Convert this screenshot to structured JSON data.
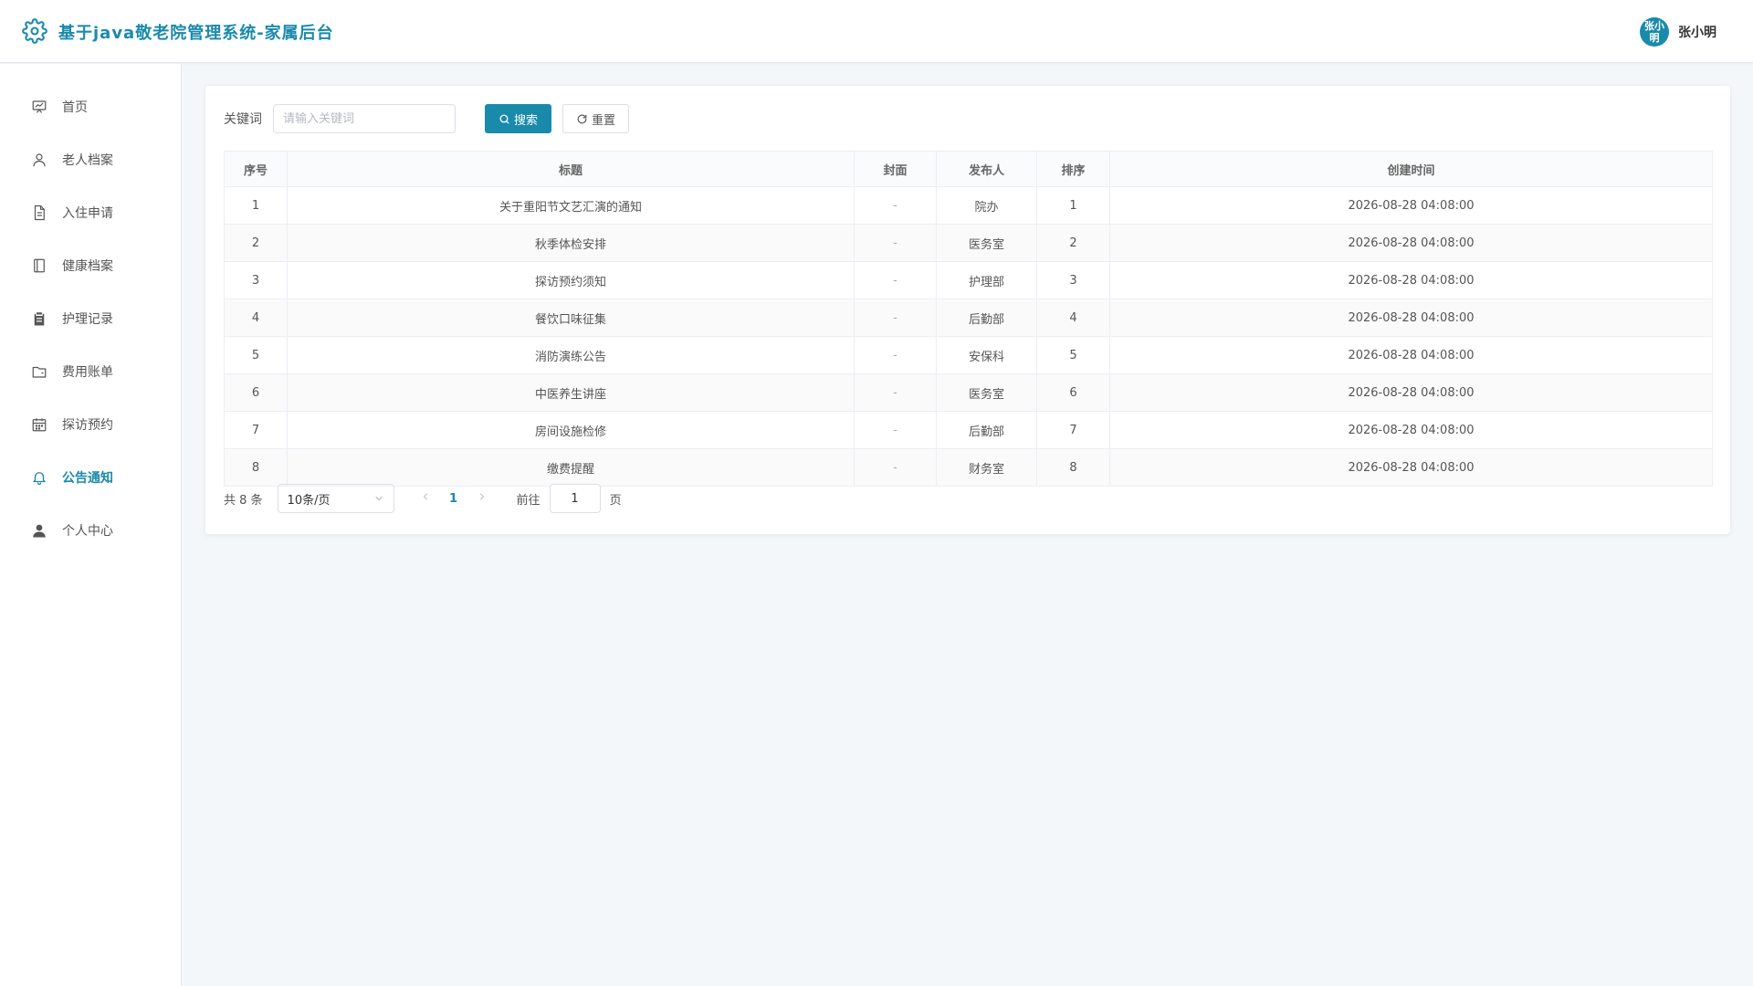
{
  "header": {
    "title": "基于java敬老院管理系统-家属后台",
    "user": {
      "avatar_text": "张小明",
      "name": "张小明"
    }
  },
  "colors": {
    "accent": "#1a8aab",
    "background": "#f4f7f9"
  },
  "sidebar": {
    "items": [
      {
        "label": "首页",
        "icon": "presentation-chart-icon",
        "active": false
      },
      {
        "label": "老人档案",
        "icon": "user-icon",
        "active": false
      },
      {
        "label": "入住申请",
        "icon": "document-icon",
        "active": false
      },
      {
        "label": "健康档案",
        "icon": "notebook-icon",
        "active": false
      },
      {
        "label": "护理记录",
        "icon": "clipboard-icon",
        "active": false
      },
      {
        "label": "费用账单",
        "icon": "wallet-icon",
        "active": false
      },
      {
        "label": "探访预约",
        "icon": "calendar-icon",
        "active": false
      },
      {
        "label": "公告通知",
        "icon": "bell-icon",
        "active": true
      },
      {
        "label": "个人中心",
        "icon": "user-solid-icon",
        "active": false
      }
    ]
  },
  "search": {
    "label": "关键词",
    "placeholder": "请输入关键词",
    "search_button": "搜索",
    "reset_button": "重置"
  },
  "table": {
    "columns": [
      "序号",
      "标题",
      "封面",
      "发布人",
      "排序",
      "创建时间"
    ],
    "rows": [
      [
        "1",
        "关于重阳节文艺汇演的通知",
        "-",
        "院办",
        "1",
        "2026-08-28 04:08:00"
      ],
      [
        "2",
        "秋季体检安排",
        "-",
        "医务室",
        "2",
        "2026-08-28 04:08:00"
      ],
      [
        "3",
        "探访预约须知",
        "-",
        "护理部",
        "3",
        "2026-08-28 04:08:00"
      ],
      [
        "4",
        "餐饮口味征集",
        "-",
        "后勤部",
        "4",
        "2026-08-28 04:08:00"
      ],
      [
        "5",
        "消防演练公告",
        "-",
        "安保科",
        "5",
        "2026-08-28 04:08:00"
      ],
      [
        "6",
        "中医养生讲座",
        "-",
        "医务室",
        "6",
        "2026-08-28 04:08:00"
      ],
      [
        "7",
        "房间设施检修",
        "-",
        "后勤部",
        "7",
        "2026-08-28 04:08:00"
      ],
      [
        "8",
        "缴费提醒",
        "-",
        "财务室",
        "8",
        "2026-08-28 04:08:00"
      ]
    ]
  },
  "pagination": {
    "total_text": "共 8 条",
    "page_size": "10条/页",
    "current_page": "1",
    "goto_label": "前往",
    "goto_value": "1",
    "page_suffix": "页"
  }
}
